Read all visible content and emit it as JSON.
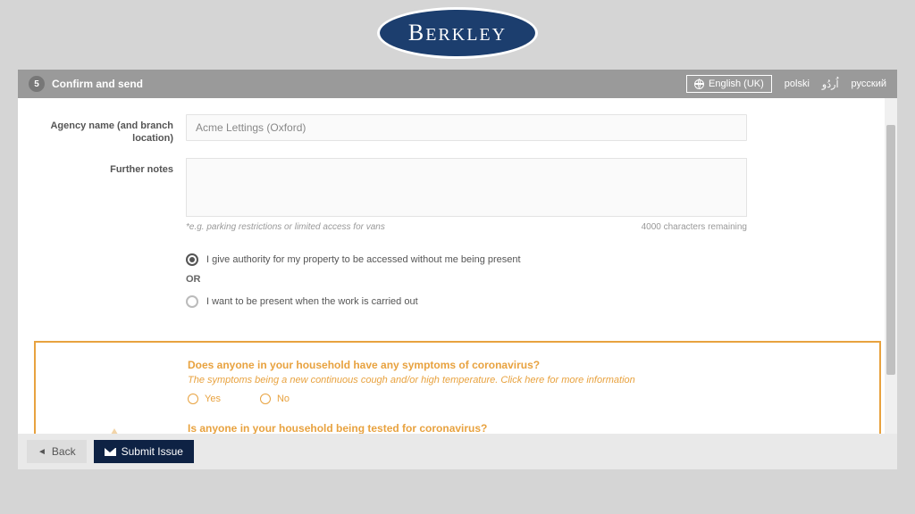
{
  "logo": {
    "text": "BERKLEY"
  },
  "step": {
    "number": "5",
    "title": "Confirm and send"
  },
  "languages": {
    "active": "English (UK)",
    "others": [
      "polski",
      "اُردُو",
      "русский"
    ]
  },
  "form": {
    "agency_label": "Agency name (and branch location)",
    "agency_value": "Acme Lettings (Oxford)",
    "notes_label": "Further notes",
    "notes_hint": "*e.g. parking restrictions or limited access for vans",
    "notes_counter": "4000 characters remaining",
    "access_authority": "I give authority for my property to be accessed without me being present",
    "or_text": "OR",
    "access_present": "I want to be present when the work is carried out"
  },
  "covid": {
    "q1": "Does anyone in your household have any symptoms of coronavirus?",
    "q1_sub_a": "The symptoms being a new continuous cough and/or high temperature. ",
    "q1_sub_link": "Click here for more information",
    "yes": "Yes",
    "no": "No",
    "q2": "Is anyone in your household being tested for coronavirus?"
  },
  "footer": {
    "back": "Back",
    "submit": "Submit Issue"
  }
}
